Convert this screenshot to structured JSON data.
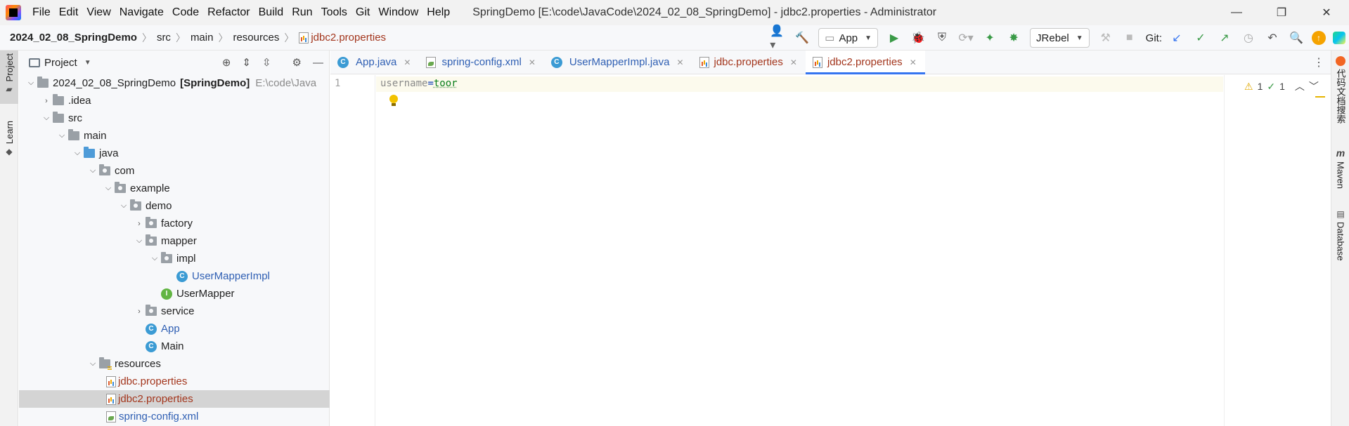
{
  "titlebar": {
    "menu": [
      "File",
      "Edit",
      "View",
      "Navigate",
      "Code",
      "Refactor",
      "Build",
      "Run",
      "Tools",
      "Git",
      "Window",
      "Help"
    ],
    "window_title": "SpringDemo [E:\\code\\JavaCode\\2024_02_08_SpringDemo] - jdbc2.properties - Administrator",
    "controls": {
      "minimize": "—",
      "restore": "❐",
      "close": "✕"
    }
  },
  "navbar": {
    "breadcrumbs": [
      "2024_02_08_SpringDemo",
      "src",
      "main",
      "resources",
      "jdbc2.properties"
    ],
    "run_config": "App",
    "jrebel": "JRebel",
    "git_label": "Git:"
  },
  "left_stripe": {
    "project": "Project",
    "learn": "Learn"
  },
  "project_panel": {
    "title": "Project",
    "tree": [
      {
        "label": "2024_02_08_SpringDemo",
        "module": "[SpringDemo]",
        "path": "E:\\code\\Java"
      },
      {
        "label": ".idea"
      },
      {
        "label": "src"
      },
      {
        "label": "main"
      },
      {
        "label": "java"
      },
      {
        "label": "com"
      },
      {
        "label": "example"
      },
      {
        "label": "demo"
      },
      {
        "label": "factory"
      },
      {
        "label": "mapper"
      },
      {
        "label": "impl"
      },
      {
        "label": "UserMapperImpl"
      },
      {
        "label": "UserMapper"
      },
      {
        "label": "service"
      },
      {
        "label": "App"
      },
      {
        "label": "Main"
      },
      {
        "label": "resources"
      },
      {
        "label": "jdbc.properties"
      },
      {
        "label": "jdbc2.properties"
      },
      {
        "label": "spring-config.xml"
      }
    ]
  },
  "editor": {
    "tabs": [
      "App.java",
      "spring-config.xml",
      "UserMapperImpl.java",
      "jdbc.properties",
      "jdbc2.properties"
    ],
    "active_tab": "jdbc2.properties",
    "line_number": "1",
    "code": {
      "key": "username",
      "eq": "=",
      "value": "toor"
    },
    "inspections": {
      "warnings": "1",
      "typos": "1"
    }
  },
  "right_stripe": {
    "doc_search": "代码文档搜索",
    "maven": "Maven",
    "database": "Database"
  },
  "colors": {
    "accent": "#3574f0",
    "file_orange": "#a3361d",
    "class_blue": "#2f5fb3",
    "selection": "#d4d4d4"
  }
}
